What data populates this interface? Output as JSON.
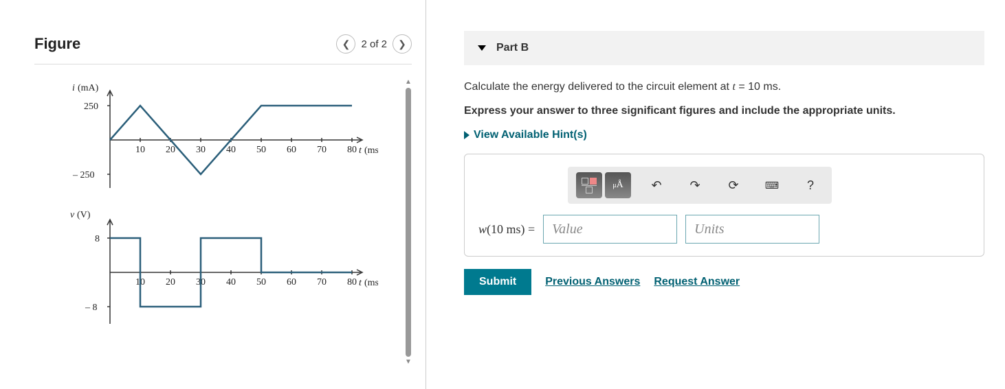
{
  "figure": {
    "title": "Figure",
    "nav_counter": "2 of 2"
  },
  "part": {
    "label": "Part B",
    "question_pre": "Calculate the energy delivered to the circuit element at ",
    "question_var": "t",
    "question_eq": " = 10 ms",
    "question_post": ".",
    "instruction": "Express your answer to three significant figures and include the appropriate units.",
    "hints_label": "View Available Hint(s)",
    "answer_label_var": "w",
    "answer_label_arg": "(10 ms) =",
    "value_placeholder": "Value",
    "units_placeholder": "Units",
    "submit": "Submit",
    "prev_answers": "Previous Answers",
    "request_answer": "Request Answer"
  },
  "chart_data": [
    {
      "type": "line",
      "title": "",
      "ylabel": "i (mA)",
      "xlabel": "t (ms)",
      "x_ticks": [
        10,
        20,
        30,
        40,
        50,
        60,
        70,
        80
      ],
      "y_ticks": [
        -250,
        250
      ],
      "xlim": [
        0,
        80
      ],
      "ylim": [
        -300,
        300
      ],
      "x": [
        0,
        10,
        30,
        50,
        80
      ],
      "y": [
        0,
        250,
        -250,
        250,
        250
      ]
    },
    {
      "type": "line",
      "title": "",
      "ylabel": "v (V)",
      "xlabel": "t (ms)",
      "x_ticks": [
        10,
        20,
        30,
        40,
        50,
        60,
        70,
        80
      ],
      "y_ticks": [
        -8,
        8
      ],
      "xlim": [
        0,
        80
      ],
      "ylim": [
        -10,
        10
      ],
      "x": [
        0,
        10,
        10,
        30,
        30,
        50,
        50,
        80
      ],
      "y": [
        8,
        8,
        -8,
        -8,
        8,
        8,
        0,
        0
      ]
    }
  ]
}
